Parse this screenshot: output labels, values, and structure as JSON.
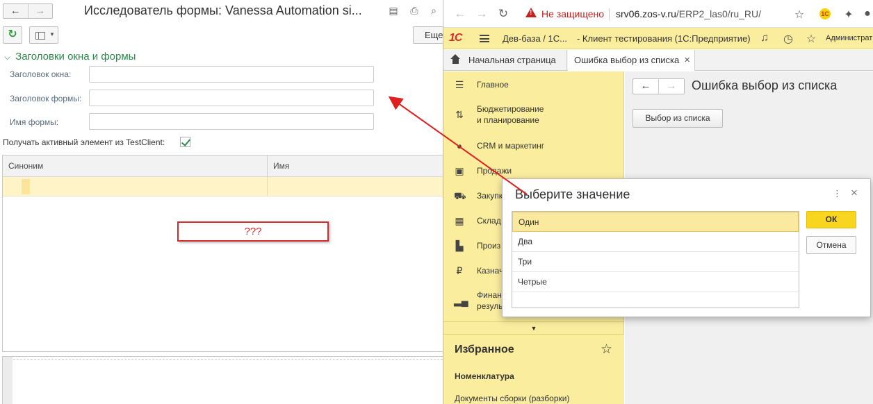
{
  "explorer": {
    "title": "Исследователь формы: Vanessa Automation si...",
    "more_label": "Еще",
    "group_title": "Заголовки окна и формы",
    "fields": [
      {
        "label": "Заголовок окна:",
        "value": ""
      },
      {
        "label": "Заголовок формы:",
        "value": ""
      },
      {
        "label": "Имя формы:",
        "value": ""
      }
    ],
    "checkbox_label": "Получать активный элемент из TestClient:",
    "checkbox_checked": true,
    "table": {
      "columns": [
        "Синоним",
        "Имя"
      ]
    },
    "callout": "???"
  },
  "browser": {
    "insecure_label": "Не защищено",
    "url_host": "srv06.zos-v.ru",
    "url_path": "/ERP2_las0/ru_RU/",
    "app_title_left": "Дев-база / 1С...",
    "app_title_right": "- Клиент тестирования (1С:Предприятие)",
    "user": "Администрат",
    "logo": "1С",
    "ext_logo": "1С",
    "tabs": [
      {
        "label": "Начальная страница"
      },
      {
        "label": "Ошибка выбор из списка"
      }
    ],
    "sidebar": [
      {
        "label": "Главное",
        "icon": "menu-icon"
      },
      {
        "label": "Бюджетирование\nи планирование",
        "icon": "budget-icon"
      },
      {
        "label": "CRM и маркетинг",
        "icon": "crm-icon"
      },
      {
        "label": "Продажи",
        "icon": "bag-icon"
      },
      {
        "label": "Закупки",
        "icon": "cart-icon"
      },
      {
        "label": "Склад",
        "icon": "warehouse-icon"
      },
      {
        "label": "Произ",
        "icon": "factory-icon"
      },
      {
        "label": "Казнач",
        "icon": "ruble-icon"
      },
      {
        "label": "Финан\nрезуль",
        "icon": "chart-icon"
      }
    ],
    "favorites": {
      "title": "Избранное",
      "items": [
        "Номенклатура",
        "Документы сборки (разборки)"
      ]
    },
    "content": {
      "title": "Ошибка выбор из списка",
      "button": "Выбор из списка"
    },
    "dialog": {
      "title": "Выберите значение",
      "items": [
        "Один",
        "Два",
        "Три",
        "Четрые"
      ],
      "selected_index": 0,
      "ok": "ОК",
      "cancel": "Отмена"
    }
  },
  "colors": {
    "accent_yellow": "#fbed9e",
    "ok_button": "#f8d51f",
    "callout_red": "#d52b2b",
    "group_green": "#2a8a4a",
    "insecure_red": "#c5221f"
  }
}
